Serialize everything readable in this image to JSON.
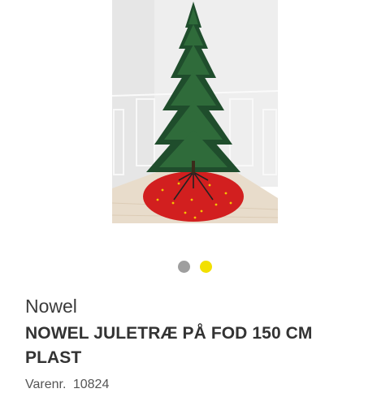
{
  "product": {
    "image_alt": "Nowel juletræ på fod",
    "brand": "Nowel",
    "title": "NOWEL JULETRÆ PÅ FOD 150 CM PLAST",
    "sku_label": "Varenr.",
    "sku_value": "10824"
  },
  "carousel": {
    "total": 2,
    "active_index": 1,
    "colors": {
      "inactive": "#9e9e9e",
      "active": "#f2e000"
    }
  }
}
